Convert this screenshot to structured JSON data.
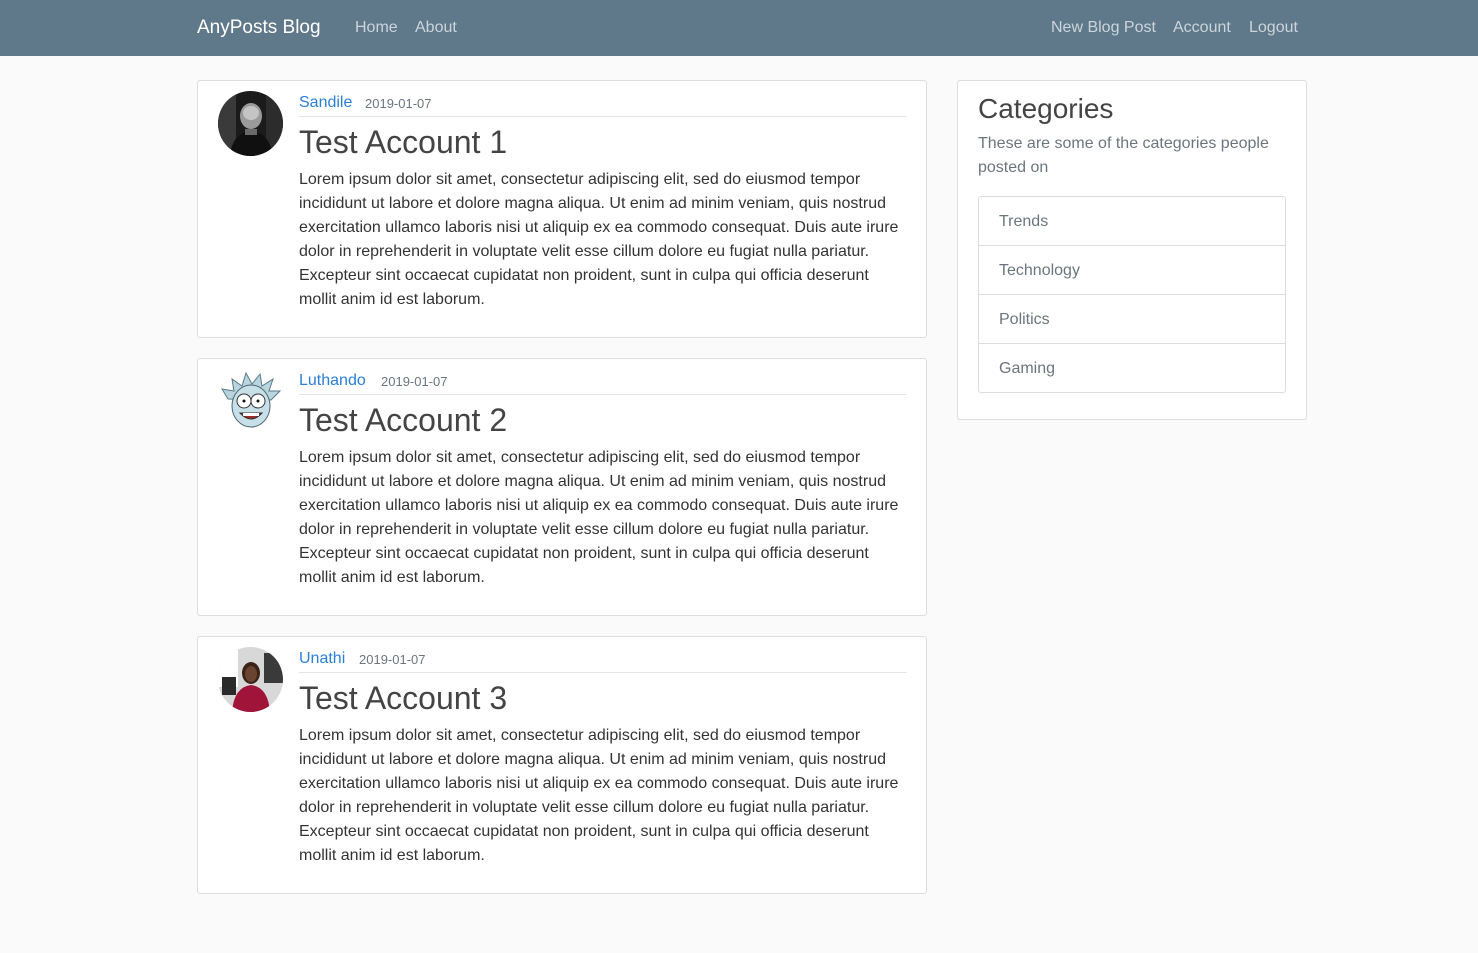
{
  "navbar": {
    "brand": "AnyPosts Blog",
    "left_links": [
      "Home",
      "About"
    ],
    "right_links": [
      "New Blog Post",
      "Account",
      "Logout"
    ]
  },
  "posts": [
    {
      "author": "Sandile",
      "date": "2019-01-07",
      "title": "Test Account 1",
      "content": "Lorem ipsum dolor sit amet, consectetur adipiscing elit, sed do eiusmod tempor incididunt ut labore et dolore magna aliqua. Ut enim ad minim veniam, quis nostrud exercitation ullamco laboris nisi ut aliquip ex ea commodo consequat. Duis aute irure dolor in reprehenderit in voluptate velit esse cillum dolore eu fugiat nulla pariatur. Excepteur sint occaecat cupidatat non proident, sunt in culpa qui officia deserunt mollit anim id est laborum."
    },
    {
      "author": "Luthando",
      "date": "2019-01-07",
      "title": "Test Account 2",
      "content": "Lorem ipsum dolor sit amet, consectetur adipiscing elit, sed do eiusmod tempor incididunt ut labore et dolore magna aliqua. Ut enim ad minim veniam, quis nostrud exercitation ullamco laboris nisi ut aliquip ex ea commodo consequat. Duis aute irure dolor in reprehenderit in voluptate velit esse cillum dolore eu fugiat nulla pariatur. Excepteur sint occaecat cupidatat non proident, sunt in culpa qui officia deserunt mollit anim id est laborum."
    },
    {
      "author": "Unathi",
      "date": "2019-01-07",
      "title": "Test Account 3",
      "content": "Lorem ipsum dolor sit amet, consectetur adipiscing elit, sed do eiusmod tempor incididunt ut labore et dolore magna aliqua. Ut enim ad minim veniam, quis nostrud exercitation ullamco laboris nisi ut aliquip ex ea commodo consequat. Duis aute irure dolor in reprehenderit in voluptate velit esse cillum dolore eu fugiat nulla pariatur. Excepteur sint occaecat cupidatat non proident, sunt in culpa qui officia deserunt mollit anim id est laborum."
    }
  ],
  "sidebar": {
    "title": "Categories",
    "description": "These are some of the categories people posted on",
    "categories": [
      "Trends",
      "Technology",
      "Politics",
      "Gaming"
    ]
  },
  "colors": {
    "navbar_bg": "#5f788a",
    "link": "#2a7fd6",
    "page_bg": "#fafafa"
  }
}
